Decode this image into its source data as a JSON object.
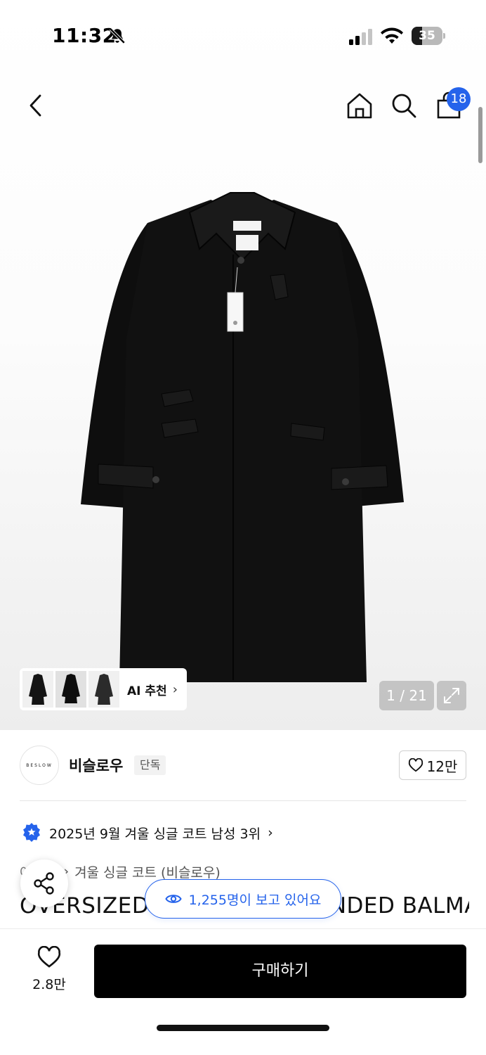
{
  "status_bar": {
    "time": "11:32",
    "battery": "35",
    "battery_level": 0.35,
    "icons": [
      "bell-slash-icon",
      "cellular-signal-icon",
      "wifi-icon",
      "battery-icon"
    ]
  },
  "header": {
    "icons": [
      "chevron-left-icon",
      "home-icon",
      "search-icon",
      "shopping-bag-icon"
    ],
    "cart_count": "18"
  },
  "gallery": {
    "ai_label": "AI 추천",
    "ai_chevron": "›",
    "counter": "1 / 21",
    "thumbnails": [
      "coat-thumbnail-1",
      "coat-thumbnail-2",
      "coat-thumbnail-3"
    ],
    "expand_icon": "expand-icon"
  },
  "brand": {
    "logo_text": "BESLOW",
    "name": "비슬로우",
    "tag": "단독",
    "like_count": "12만"
  },
  "ranking": {
    "text": "2025년 9월 겨울 싱글 코트 남성 3위",
    "chevron": "›"
  },
  "category": {
    "first": "아우터",
    "separator": "›",
    "second": "겨울 싱글 코트 (비슬로우)"
  },
  "product": {
    "title": "OVERSIZED CASHMERE BLENDED BALMACAAN COAT"
  },
  "overlay": {
    "viewers_text": "1,255명이 보고 있어요",
    "share_icon": "share-icon"
  },
  "bottom_bar": {
    "like_count": "2.8만",
    "buy_label": "구매하기"
  },
  "colors": {
    "accent": "#2563eb",
    "buy_button": "#000000"
  }
}
